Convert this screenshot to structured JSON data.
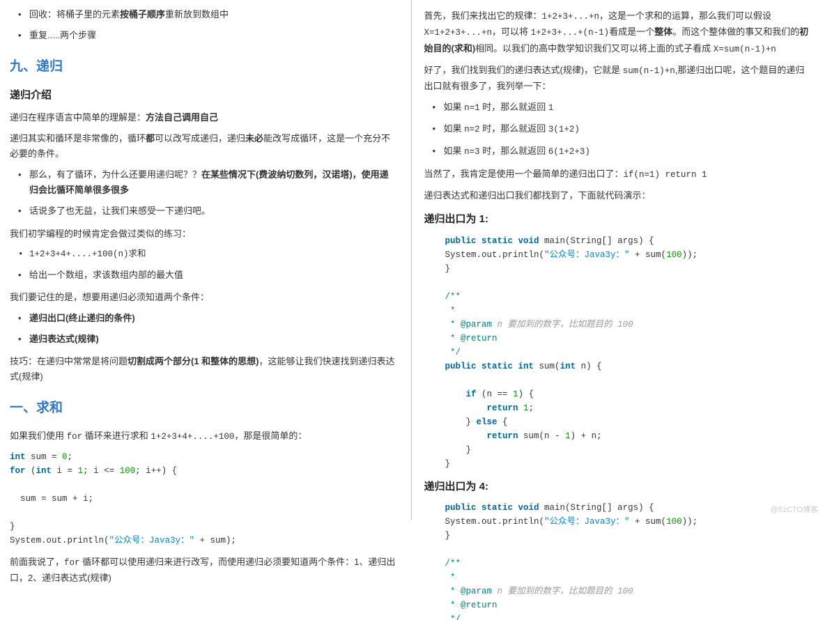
{
  "left": {
    "bullets_top": [
      {
        "pre": "回收：将桶子里的元素",
        "b": "按桶子顺序",
        "post": "重新放到数组中"
      },
      {
        "pre": "重复.....两个步骤",
        "b": "",
        "post": ""
      }
    ],
    "h2": "九、递归",
    "h3_intro": "递归介绍",
    "p1_pre": "递归在程序语言中简单的理解是：",
    "p1_b": "方法自己调用自己",
    "p2_a": "递归其实和循环是非常像的，循环",
    "p2_b": "都",
    "p2_c": "可以改写成递归，递归",
    "p2_d": "未必",
    "p2_e": "能改写成循环，这是一个充分不必要的条件。",
    "bullets_mid": [
      {
        "pre": "那么，有了循环，为什么还要用递归呢？？",
        "b": "在某些情况下(费波纳切数列，汉诺塔)，使用递归会比循环简单很多很多",
        "post": ""
      },
      {
        "pre": "话说多了也无益，让我们来感受一下递归吧。",
        "b": "",
        "post": ""
      }
    ],
    "p3": "我们初学编程的时候肯定会做过类似的练习：",
    "bullets_ex": [
      "1+2+3+4+....+100(n)求和",
      "给出一个数组，求该数组内部的最大值"
    ],
    "p4": "我们要记住的是，想要用递归必须知道两个条件：",
    "bullets_rule": [
      "递归出口(终止递归的条件)",
      "递归表达式(规律)"
    ],
    "p5_pre": "技巧：在递归中常常是将问题",
    "p5_b": "切割成两个部分(1 和整体的思想)",
    "p5_post": "，这能够让我们快速找到递归表达式(规律)",
    "h2_sum": "一、求和",
    "p6_a": "如果我们使用 ",
    "p6_code": "for",
    "p6_b": " 循环来进行求和 ",
    "p6_code2": "1+2+3+4+....+100",
    "p6_c": "，那是很简单的：",
    "code1_l1a": "int",
    "code1_l1b": " sum = ",
    "code1_l1c": "0",
    "code1_l1d": ";",
    "code1_l2a": "for",
    "code1_l2b": " (",
    "code1_l2c": "int",
    "code1_l2d": " i = ",
    "code1_l2e": "1",
    "code1_l2f": "; i <= ",
    "code1_l2g": "100",
    "code1_l2h": "; i++) {",
    "code1_l3": "  sum = sum + i;",
    "code1_l4": "}",
    "code1_l5a": "System.out.println(",
    "code1_l5b": "\"公众号：Java3y：\"",
    "code1_l5c": " + sum);",
    "p7_a": "前面我说了，",
    "p7_code": "for",
    "p7_b": " 循环都可以使用递归来进行改写，而使用递归必须要知道两个条件：1、递归出口，2、递归表达式(规律)"
  },
  "right": {
    "p1_a": "首先，我们来找出它的规律：",
    "p1_code1": "1+2+3+...+n",
    "p1_b": "，这是一个求和的运算，那么我们可以假设 ",
    "p1_code2": "X=1+2+3+...+n",
    "p1_c": "，可以将 ",
    "p1_code3": "1+2+3+...+(n-1)",
    "p1_d": "看成是一个",
    "p1_bold1": "整体",
    "p1_e": "。而这个整体做的事又和我们的",
    "p1_bold2": "初始目的(求和)",
    "p1_f": "相同。以我们的高中数学知识我们又可以将上面的式子看成 ",
    "p1_code4": "X=sum(n-1)+n",
    "p2_a": "好了，我们找到我们的递归表达式(规律)，它就是 ",
    "p2_code": "sum(n-1)+n",
    "p2_b": ",那递归出口呢，这个题目的递归出口就有很多了，我列举一下：",
    "bullets": [
      {
        "a": "如果 ",
        "code": "n=1",
        "b": " 时，那么就返回 ",
        "tail": "1"
      },
      {
        "a": "如果 ",
        "code": "n=2",
        "b": " 时，那么就返回 ",
        "tail": "3(1+2)"
      },
      {
        "a": "如果 ",
        "code": "n=3",
        "b": " 时，那么就返回 ",
        "tail": "6(1+2+3)"
      }
    ],
    "p3_a": "当然了，我肯定是使用一个最简单的递归出口了：",
    "p3_code": "if(n=1) return 1",
    "p4": "递归表达式和递归出口我们都找到了，下面就代码演示：",
    "h_code1": "递归出口为 1:",
    "code1": {
      "l1": "public static void main(String[] args) {",
      "l2a": "    System.out.println(",
      "l2b": "\"公众号：Java3y：\"",
      "l2c": " + sum(",
      "l2d": "100",
      "l2e": "));",
      "l3": "}",
      "l4": "/**",
      "l5": " *",
      "l6a": " * ",
      "l6b": "@param",
      "l6c": " n 要加到的数字，比如题目的 ",
      "l6d": "100",
      "l7a": " * ",
      "l7b": "@return",
      "l8": " */",
      "l9": "public static int sum(int n) {",
      "l10a": "    if",
      "l10b": " (n == ",
      "l10c": "1",
      "l10d": ") {",
      "l11a": "        return ",
      "l11b": "1",
      "l11c": ";",
      "l12a": "    } ",
      "l12b": "else",
      "l12c": " {",
      "l13a": "        return",
      "l13b": " sum(n - ",
      "l13c": "1",
      "l13d": ") + n;",
      "l14": "    }",
      "l15": "}"
    },
    "h_code2": "递归出口为 4:",
    "code2": {
      "l1": "public static void main(String[] args) {",
      "l2a": "    System.out.println(",
      "l2b": "\"公众号：Java3y：\"",
      "l2c": " + sum(",
      "l2d": "100",
      "l2e": "));",
      "l3": "}",
      "l4": "/**",
      "l5": " *",
      "l6a": " * ",
      "l6b": "@param",
      "l6c": " n 要加到的数字，比如题目的 ",
      "l6d": "100",
      "l7a": " * ",
      "l7b": "@return",
      "l8": " */"
    }
  },
  "watermark": "@51CTO博客"
}
